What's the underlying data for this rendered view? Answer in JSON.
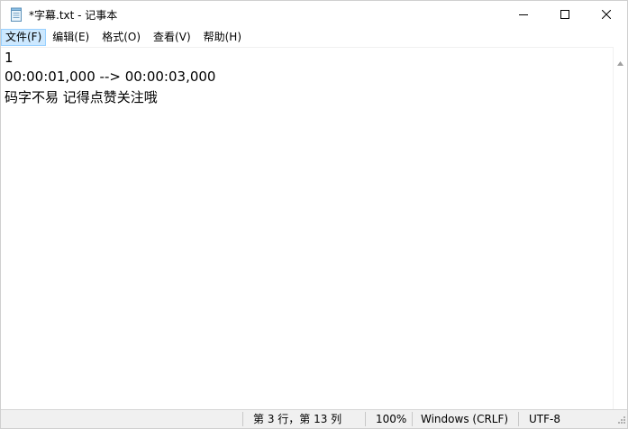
{
  "window": {
    "title": "*字幕.txt - 记事本"
  },
  "menu": {
    "items": [
      {
        "label": "文件(F)",
        "active": true
      },
      {
        "label": "编辑(E)",
        "active": false
      },
      {
        "label": "格式(O)",
        "active": false
      },
      {
        "label": "查看(V)",
        "active": false
      },
      {
        "label": "帮助(H)",
        "active": false
      }
    ]
  },
  "editor": {
    "lines": [
      "1",
      "00:00:01,000 --> 00:00:03,000",
      "码字不易 记得点赞关注哦"
    ]
  },
  "status": {
    "position": "第 3 行，第 13 列",
    "zoom": "100%",
    "line_ending": "Windows (CRLF)",
    "encoding": "UTF-8"
  },
  "icons": {
    "app": "notepad-icon",
    "minimize": "minimize-icon",
    "maximize": "maximize-icon",
    "close": "close-icon",
    "scroll_up": "scroll-up-arrow-icon",
    "resize": "resize-grip-icon"
  }
}
